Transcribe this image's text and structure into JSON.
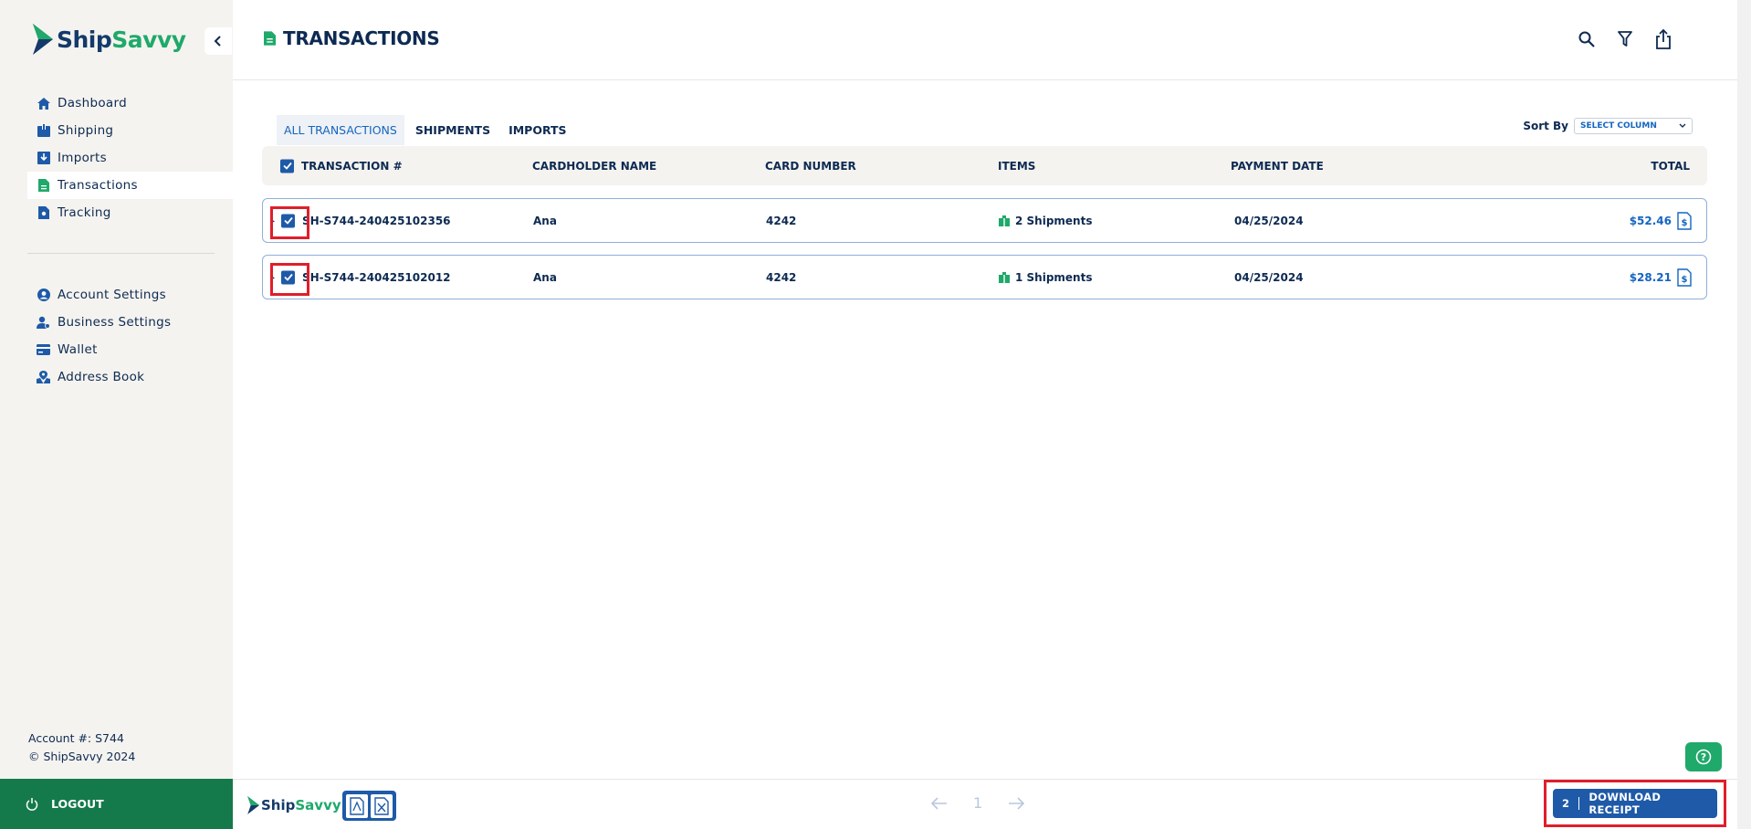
{
  "brand": {
    "name_part1": "Ship",
    "name_part2": "Savvy"
  },
  "sidebar": {
    "main_items": [
      {
        "label": "Dashboard",
        "icon": "home-icon"
      },
      {
        "label": "Shipping",
        "icon": "box-icon"
      },
      {
        "label": "Imports",
        "icon": "import-icon"
      },
      {
        "label": "Transactions",
        "icon": "document-icon",
        "active": true
      },
      {
        "label": "Tracking",
        "icon": "tracking-icon"
      }
    ],
    "secondary_items": [
      {
        "label": "Account Settings",
        "icon": "user-circle-icon"
      },
      {
        "label": "Business Settings",
        "icon": "business-user-icon"
      },
      {
        "label": "Wallet",
        "icon": "wallet-icon"
      },
      {
        "label": "Address Book",
        "icon": "address-book-icon"
      }
    ],
    "account_number": "Account #: S744",
    "copyright": "© ShipSavvy 2024",
    "logout_label": "LOGOUT"
  },
  "header": {
    "title": "TRANSACTIONS"
  },
  "tabs": [
    {
      "label": "ALL TRANSACTIONS",
      "active": true
    },
    {
      "label": "SHIPMENTS"
    },
    {
      "label": "IMPORTS"
    }
  ],
  "sort": {
    "label": "Sort By",
    "selected": "SELECT COLUMN"
  },
  "table": {
    "columns": [
      "TRANSACTION #",
      "CARDHOLDER NAME",
      "CARD NUMBER",
      "ITEMS",
      "PAYMENT DATE",
      "TOTAL"
    ],
    "rows": [
      {
        "transaction": "SH-S744-240425102356",
        "cardholder": "Ana",
        "card": "4242",
        "items": "2 Shipments",
        "date": "04/25/2024",
        "total": "$52.46"
      },
      {
        "transaction": "SH-S744-240425102012",
        "cardholder": "Ana",
        "card": "4242",
        "items": "1 Shipments",
        "date": "04/25/2024",
        "total": "$28.21"
      }
    ]
  },
  "footer": {
    "brand": {
      "name_part1": "Ship",
      "name_part2": "Savvy"
    },
    "page_number": "1",
    "selected_count": "2",
    "download_label": "DOWNLOAD RECEIPT"
  },
  "colors": {
    "primary": "#1e5aa8",
    "accent_green": "#1fa96a",
    "logout_green": "#157a4b",
    "navy": "#0d2a52",
    "highlight_red": "#e01e2b"
  }
}
